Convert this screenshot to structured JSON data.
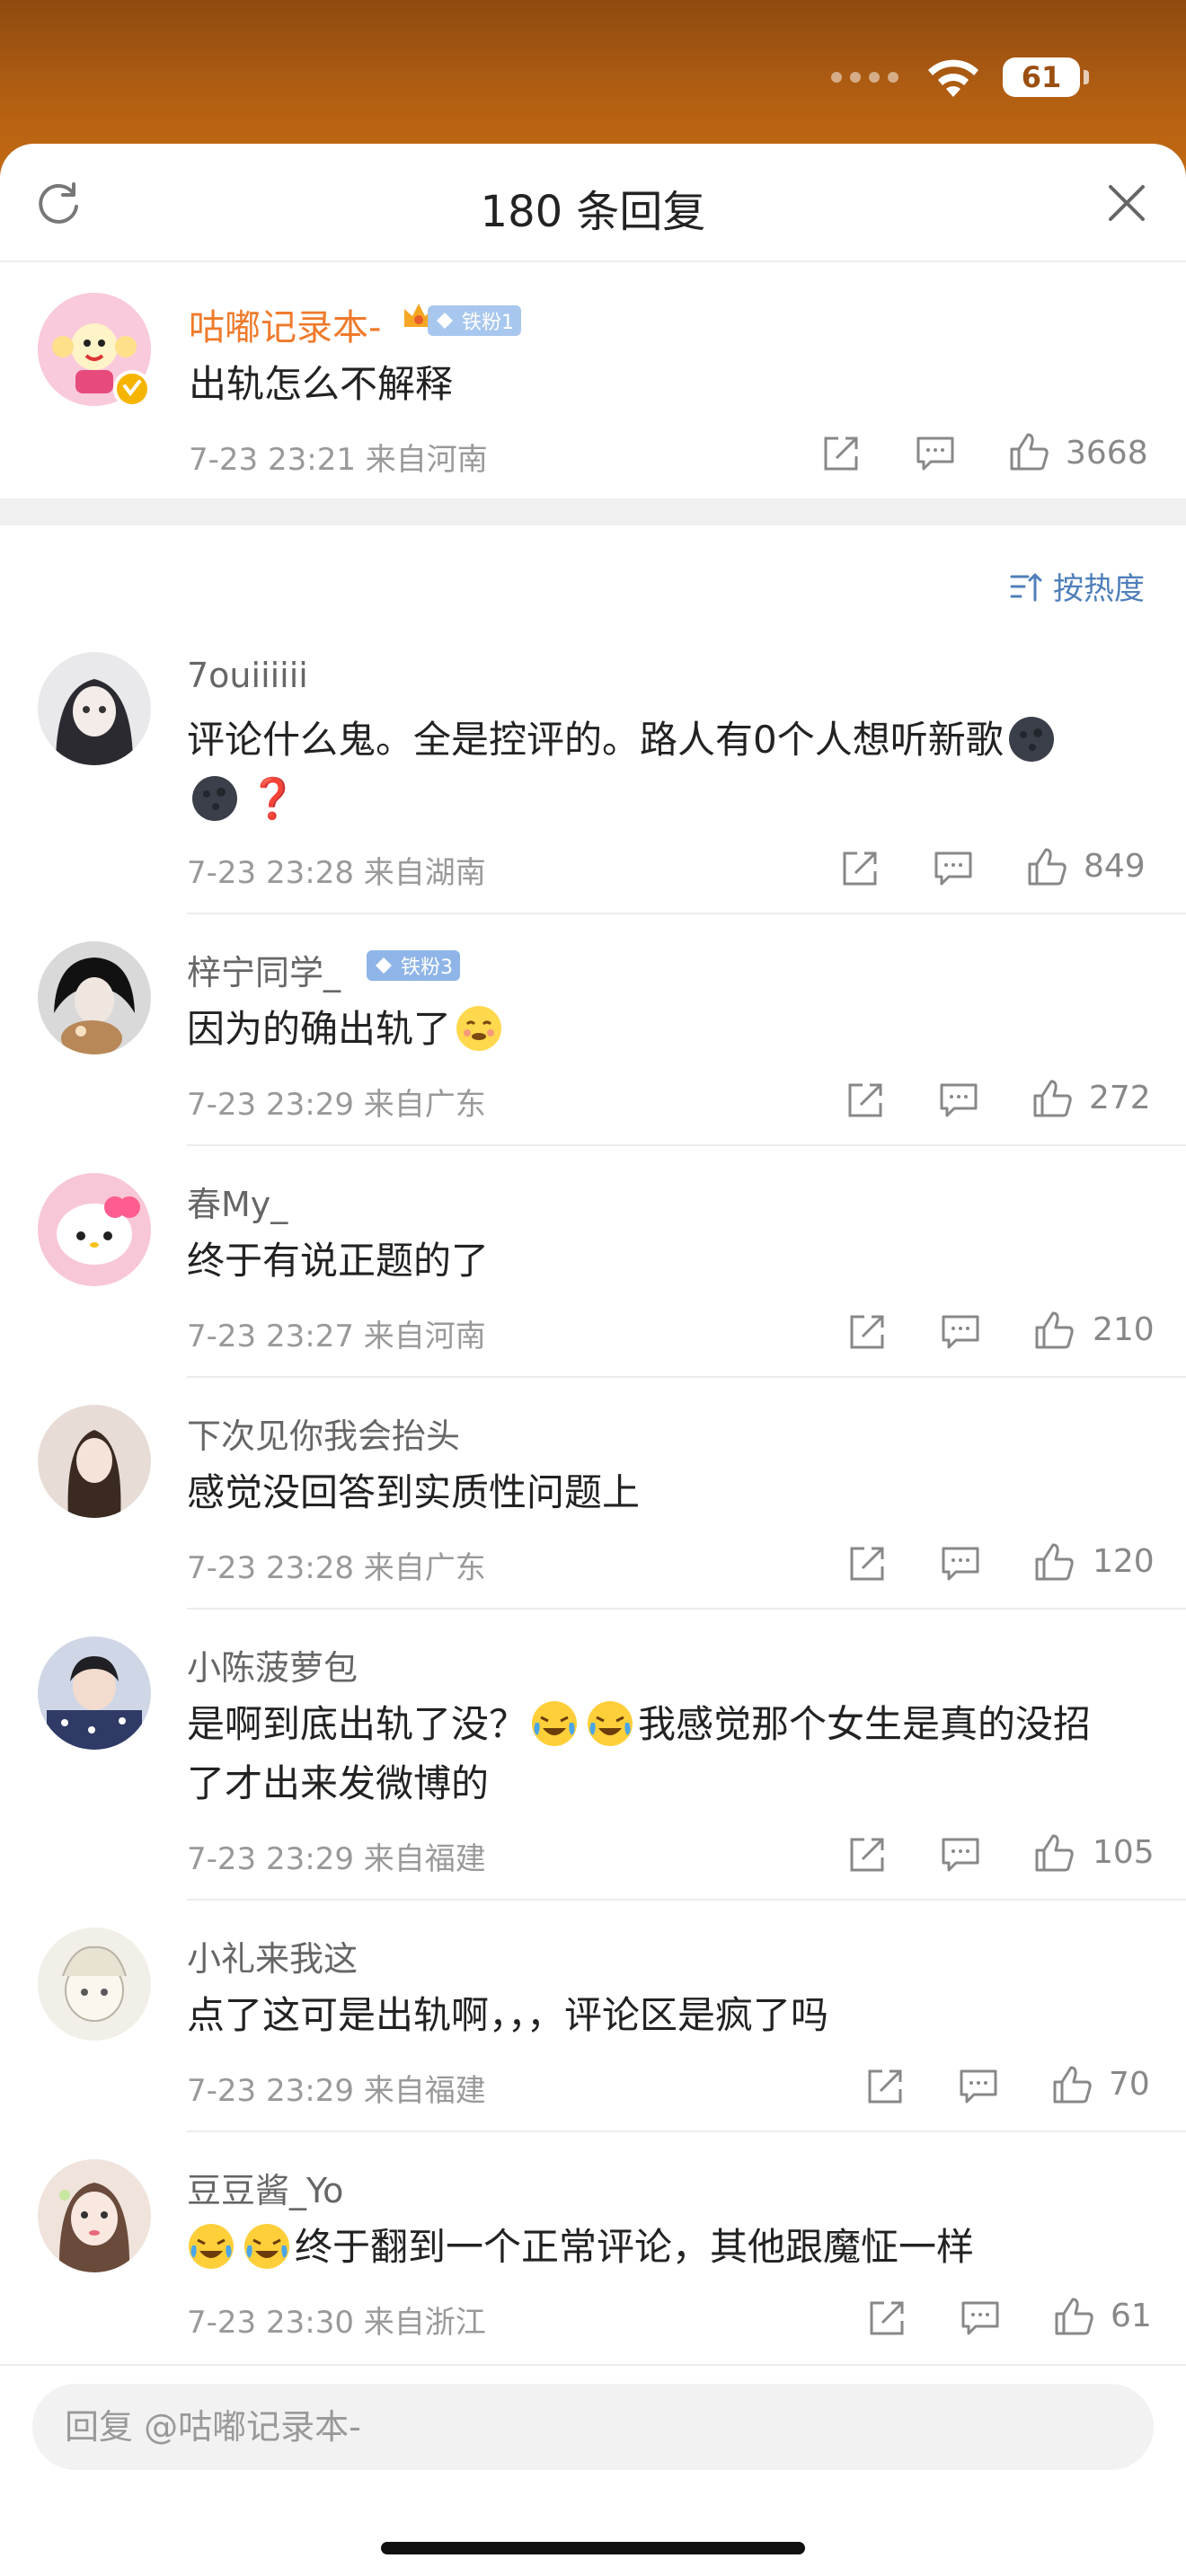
{
  "status_bar": {
    "battery": "61"
  },
  "header": {
    "title": "180 条回复"
  },
  "root_comment": {
    "username": "咕嘟记录本-",
    "fan_badge": "铁粉1",
    "text": "出轨怎么不解释",
    "time": "7-23 23:21 来自河南",
    "likes": "3668"
  },
  "sort": {
    "label": "按热度"
  },
  "replies": [
    {
      "username": "7ouiiiiii",
      "line1": "评论什么鬼。全是控评的。路人有0个人想听新歌",
      "line2_mark": "❓",
      "time": "7-23 23:28 来自湖南",
      "likes": "849"
    },
    {
      "username": "梓宁同学_",
      "fan_badge": "铁粉3",
      "text": "因为的确出轨了",
      "time": "7-23 23:29 来自广东",
      "likes": "272"
    },
    {
      "username": "春My_",
      "text": "终于有说正题的了",
      "time": "7-23 23:27 来自河南",
      "likes": "210"
    },
    {
      "username": "下次见你我会抬头",
      "text": "感觉没回答到实质性问题上",
      "time": "7-23 23:28 来自广东",
      "likes": "120"
    },
    {
      "username": "小陈菠萝包",
      "line1_a": "是啊到底出轨了没？",
      "line1_b": "我感觉那个女生是真的没招",
      "line2": "了才出来发微博的",
      "time": "7-23 23:29 来自福建",
      "likes": "105"
    },
    {
      "username": "小礼来我这",
      "text": "点了这可是出轨啊，，，评论区是疯了吗",
      "time": "7-23 23:29 来自福建",
      "likes": "70"
    },
    {
      "username": "豆豆酱_Yo",
      "text": "终于翻到一个正常评论，其他跟魔怔一样",
      "time": "7-23 23:30 来自浙江",
      "likes": "61"
    }
  ],
  "reply_box": {
    "placeholder": "回复 @咕嘟记录本-"
  },
  "colors": {
    "accent_orange": "#ef7a2b",
    "link_blue": "#4f7fba",
    "fan_badge_blue": "#8fb5e8"
  }
}
